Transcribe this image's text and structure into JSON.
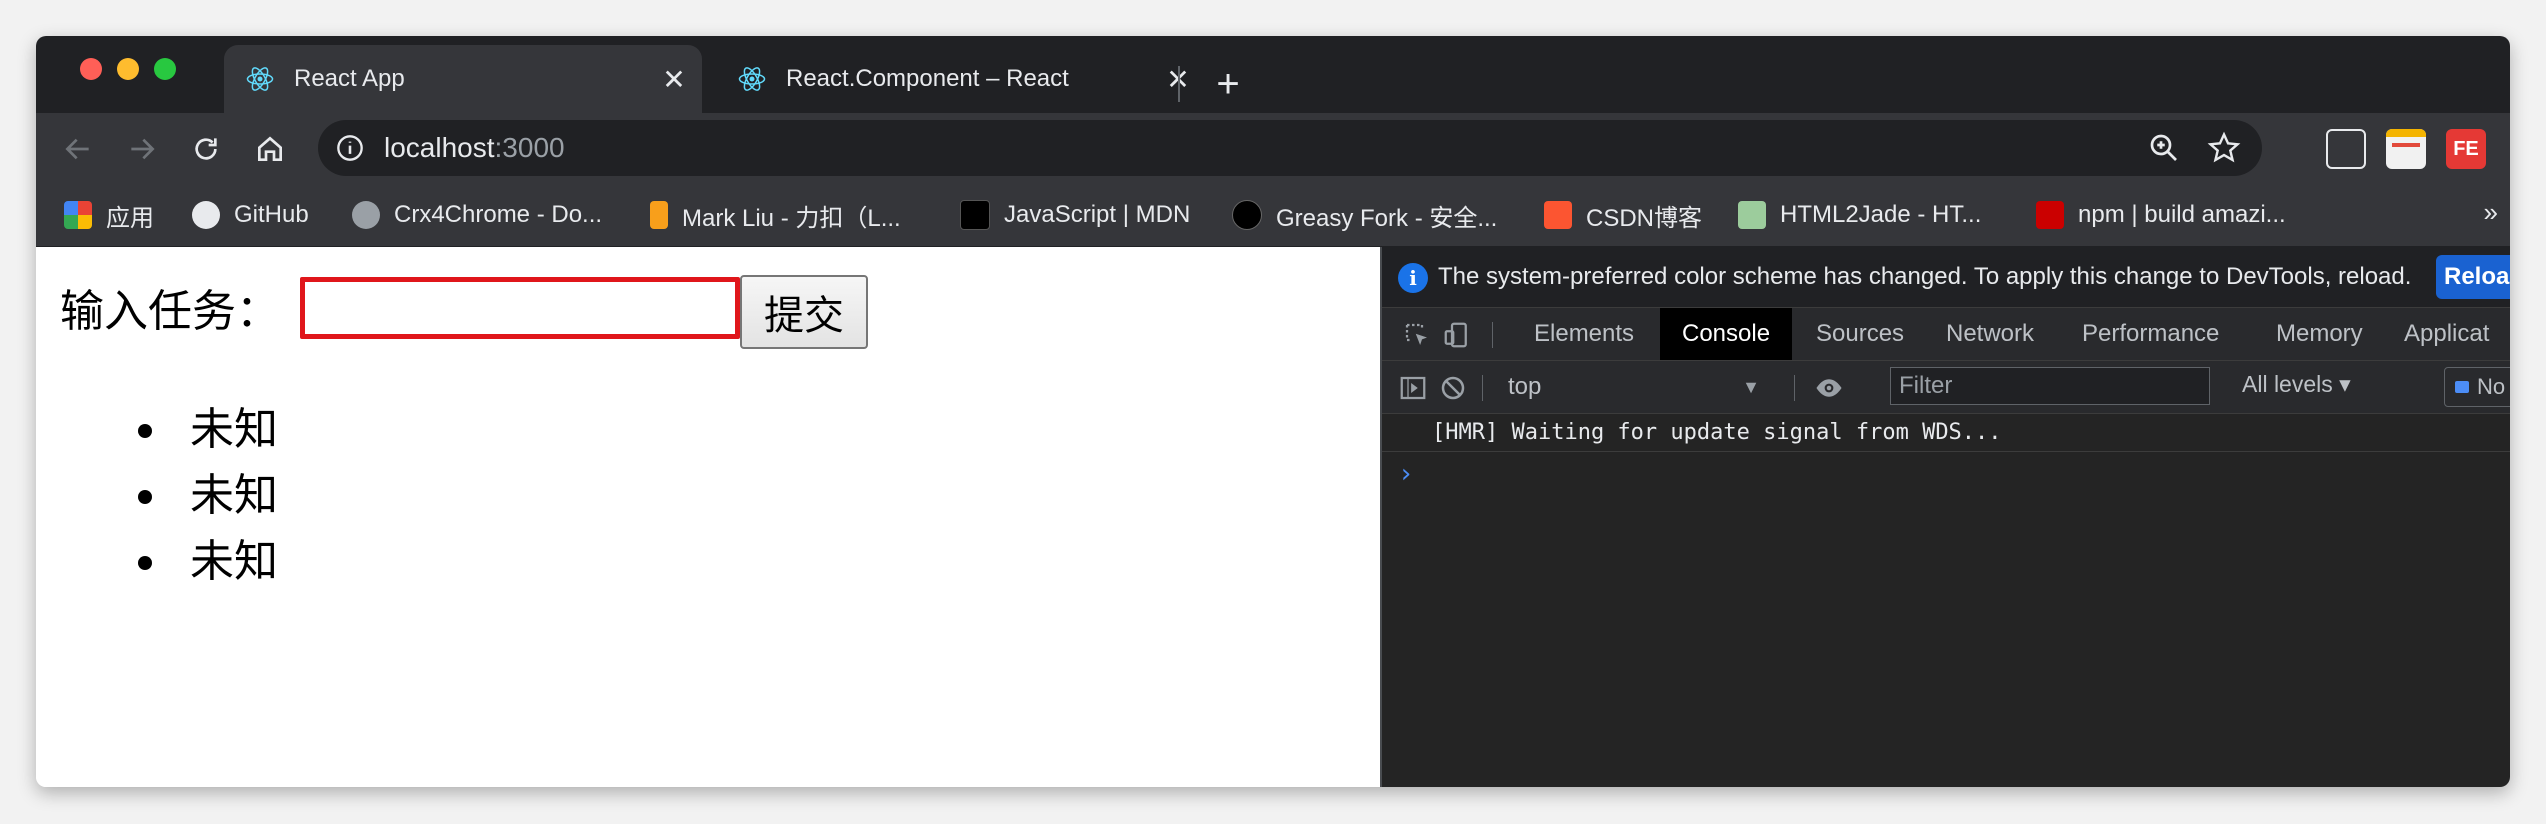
{
  "browser": {
    "tabs": [
      {
        "title": "React App",
        "active": true,
        "close": "✕"
      },
      {
        "title": "React.Component – React",
        "active": false,
        "close": "✕"
      }
    ],
    "new_tab": "+",
    "url_host": "localhost",
    "url_port": ":3000",
    "bookmarks": [
      {
        "label": "应用",
        "icon": "apps-grid-icon"
      },
      {
        "label": "GitHub",
        "icon": "github-icon"
      },
      {
        "label": "Crx4Chrome - Do...",
        "icon": "crx4chrome-icon"
      },
      {
        "label": "Mark Liu - 力扣（L...",
        "icon": "leetcode-icon"
      },
      {
        "label": "JavaScript | MDN",
        "icon": "mdn-icon"
      },
      {
        "label": "Greasy Fork - 安全...",
        "icon": "greasyfork-icon"
      },
      {
        "label": "CSDN博客",
        "icon": "csdn-icon"
      },
      {
        "label": "HTML2Jade - HT...",
        "icon": "html2jade-icon"
      },
      {
        "label": "npm | build amazi...",
        "icon": "npm-icon"
      }
    ],
    "bookmarks_more": "»"
  },
  "page": {
    "task_label": "输入任务：",
    "task_input_value": "",
    "submit_label": "提交",
    "tasks": [
      "未知",
      "未知",
      "未知"
    ]
  },
  "devtools": {
    "info_message": "The system-preferred color scheme has changed. To apply this change to DevTools, reload.",
    "reload_label": "Reload",
    "tabs": [
      "Elements",
      "Console",
      "Sources",
      "Network",
      "Performance",
      "Memory",
      "Applicat"
    ],
    "active_tab": "Console",
    "context": "top",
    "filter_placeholder": "Filter",
    "levels": "All levels ▾",
    "issues": "No Issues",
    "log_line": "[HMR] Waiting for update signal from WDS...",
    "prompt": "›"
  },
  "colors": {
    "accent": "#1a73e8",
    "input_border": "#e0161b",
    "chrome_dark": "#202124",
    "toolbar": "#35363a"
  }
}
